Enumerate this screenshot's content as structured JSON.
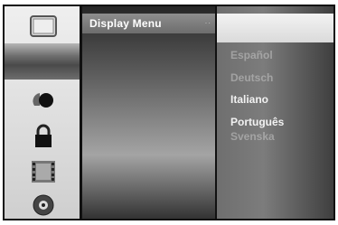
{
  "menu": {
    "title": "Display Menu",
    "icons": [
      "tv-screen-icon",
      "blank-slot-icon",
      "audio-disc-icon",
      "lock-icon",
      "film-strip-icon",
      "disc-icon"
    ],
    "options": [
      "Español",
      "Deutsch",
      "Italiano",
      "Português",
      "Svenska"
    ]
  }
}
